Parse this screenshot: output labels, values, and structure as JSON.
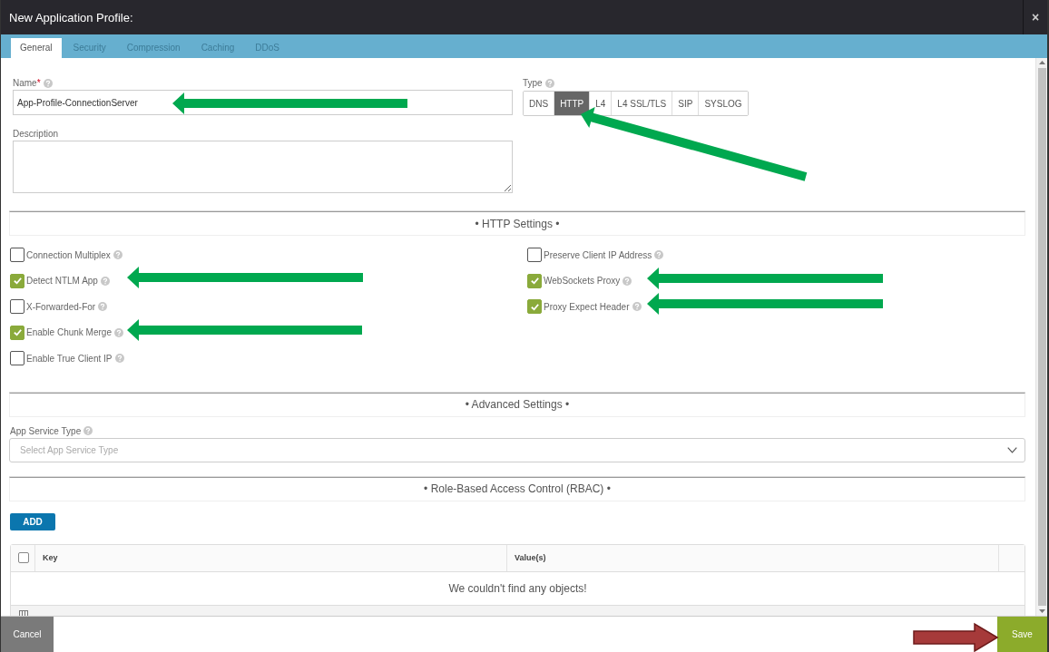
{
  "window": {
    "title": "New Application Profile:",
    "close": "×"
  },
  "tabs": [
    {
      "label": "General",
      "selected": true
    },
    {
      "label": "Security",
      "selected": false
    },
    {
      "label": "Compression",
      "selected": false
    },
    {
      "label": "Caching",
      "selected": false
    },
    {
      "label": "DDoS",
      "selected": false
    }
  ],
  "general": {
    "name": {
      "label": "Name",
      "required_mark": "*",
      "help": true,
      "value": "App-Profile-ConnectionServer"
    },
    "type": {
      "label": "Type",
      "help": true,
      "options": [
        {
          "label": "DNS",
          "selected": false
        },
        {
          "label": "HTTP",
          "selected": true
        },
        {
          "label": "L4",
          "selected": false
        },
        {
          "label": "L4 SSL/TLS",
          "selected": false
        },
        {
          "label": "SIP",
          "selected": false
        },
        {
          "label": "SYSLOG",
          "selected": false
        }
      ]
    },
    "description": {
      "label": "Description"
    }
  },
  "http_settings": {
    "title": "• HTTP Settings •",
    "columns": [
      {
        "options": [
          {
            "label": "Connection Multiplex",
            "checked": false,
            "help": true
          },
          {
            "label": "Detect NTLM App",
            "checked": true,
            "help": true
          },
          {
            "label": "X-Forwarded-For",
            "checked": false,
            "help": true
          },
          {
            "label": "Enable Chunk Merge",
            "checked": true,
            "help": true
          },
          {
            "label": "Enable True Client IP",
            "checked": false,
            "help": true
          }
        ]
      },
      {
        "options": [
          {
            "label": "Preserve Client IP Address",
            "checked": false,
            "help": true
          },
          {
            "label": "WebSockets Proxy",
            "checked": true,
            "help": true
          },
          {
            "label": "Proxy Expect Header",
            "checked": true,
            "help": true
          }
        ]
      }
    ]
  },
  "advanced_settings": {
    "title": "• Advanced Settings •",
    "app_service_type": {
      "label": "App Service Type",
      "help": true,
      "placeholder": "Select App Service Type"
    }
  },
  "rbac": {
    "title": "• Role-Based Access Control (RBAC) •",
    "add_button": "ADD",
    "table": {
      "select_all_checked": false,
      "columns": [
        "Key",
        "Value(s)"
      ],
      "empty_message": "We couldn't find any objects!"
    }
  },
  "footer": {
    "buttons": [
      {
        "label": "Cancel",
        "kind": "cancel"
      },
      {
        "label": "Save",
        "kind": "save"
      }
    ]
  }
}
